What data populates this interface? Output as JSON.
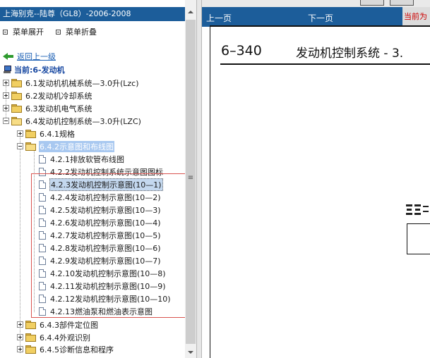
{
  "left": {
    "header": "上海别克--陆尊（GL8）-2006-2008",
    "expand_label": "菜单展开",
    "collapse_label": "菜单折叠",
    "back_label": "返回上一级",
    "current_label": "当前:6-发动机",
    "tree": {
      "l1": [
        "6.1发动机机械系统—3.0升(Lzc)",
        "6.2发动机冷却系统",
        "6.3发动机电气系统",
        "6.4发动机控制系统—3.0升(LZC)"
      ],
      "l2": [
        "6.4.1规格",
        "6.4.2示意图和布线图",
        "6.4.3部件定位图",
        "6.4.4外观识别",
        "6.4.5诊断信息和程序"
      ],
      "l3": [
        "4.2.1排放软管布线图",
        "4.2.2发动机控制系统示意图图标",
        "4.2.3发动机控制示意图(10—1)",
        "4.2.4发动机控制示意图(10—2)",
        "4.2.5发动机控制示意图(10—3)",
        "4.2.6发动机控制示意图(10—4)",
        "4.2.7发动机控制示意图(10—5)",
        "4.2.8发动机控制示意图(10—6)",
        "4.2.9发动机控制示意图(10—7)",
        "4.2.10发动机控制示意图(10—8)",
        "4.2.11发动机控制示意图(10—9)",
        "4.2.12发动机控制示意图(10—10)",
        "4.2.13燃油泵和燃油表示意图"
      ]
    }
  },
  "right": {
    "prev_label": "上一页",
    "next_label": "下一页",
    "current_label": "当前为",
    "page_number": "6–340",
    "page_title": "发动机控制系统 - 3."
  },
  "colors": {
    "header_bg": "#1c5d9a",
    "selected_bg": "#a8c8f0",
    "highlight_box": "#d9534f",
    "current_text": "#cc0000"
  }
}
